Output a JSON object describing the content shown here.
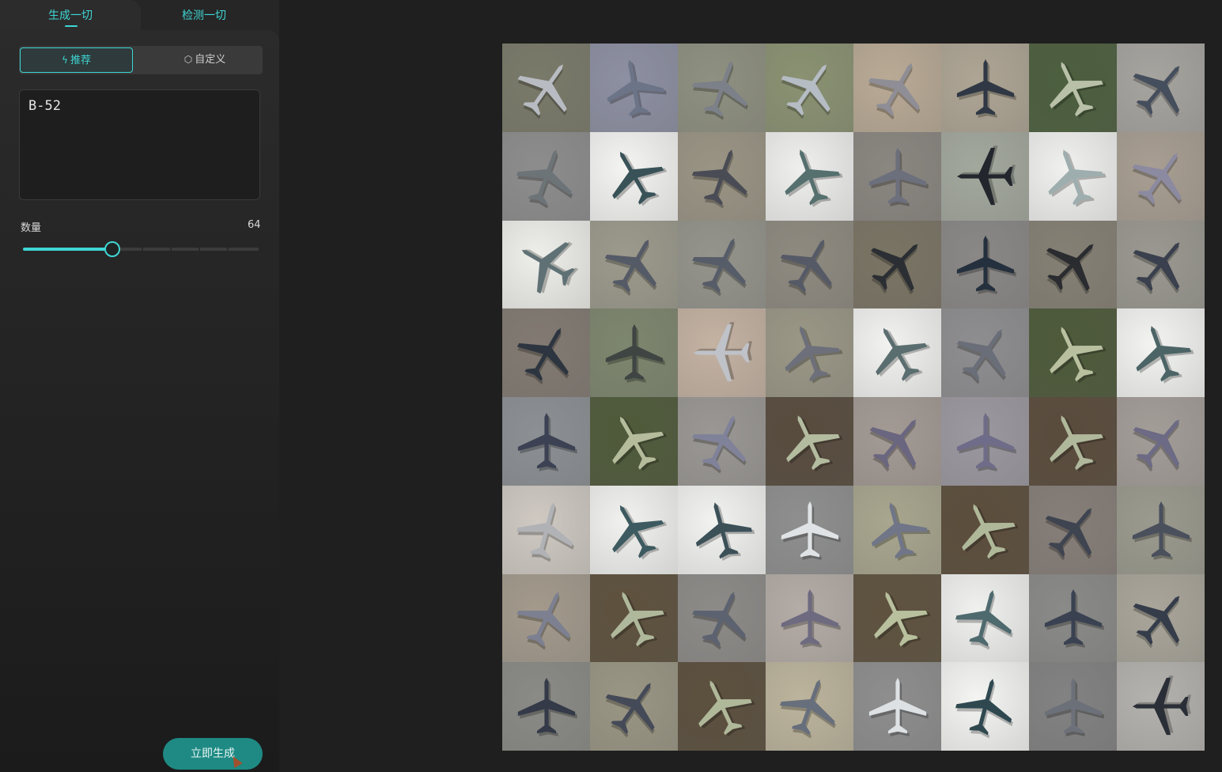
{
  "tabs": [
    {
      "label": "生成一切",
      "active": true
    },
    {
      "label": "检测一切",
      "active": false
    }
  ],
  "mode": {
    "recommend_icon": "lightning-icon",
    "recommend_label": "推荐",
    "custom_icon": "cube-icon",
    "custom_label": "自定义",
    "selected": "recommend"
  },
  "prompt": {
    "value": "B-52"
  },
  "count": {
    "label": "数量",
    "value": "64",
    "min": 0,
    "max": 170
  },
  "generate_button": {
    "label": "立即生成"
  },
  "colors": {
    "accent": "#3fd6d4",
    "button": "#1f8a84"
  },
  "results": {
    "count": 64,
    "subject": "B-52 aircraft satellite images",
    "tiles": [
      {
        "bg": "#7a7a6a",
        "plane": "#b8bcc2",
        "rot": 35
      },
      {
        "bg": "#8d90a2",
        "plane": "#6c7488",
        "rot": -10
      },
      {
        "bg": "#8e9080",
        "plane": "#7c8088",
        "rot": 20
      },
      {
        "bg": "#8a9272",
        "plane": "#b6bcc4",
        "rot": 35
      },
      {
        "bg": "#b9aa95",
        "plane": "#8f8e96",
        "rot": 30
      },
      {
        "bg": "#aea594",
        "plane": "#2f3844",
        "rot": 0
      },
      {
        "bg": "#4c5f3e",
        "plane": "#b9c0a8",
        "rot": -25
      },
      {
        "bg": "#a6a49f",
        "plane": "#454e5c",
        "rot": 40
      },
      {
        "bg": "#8d8d8d",
        "plane": "#6d7478",
        "rot": 20
      },
      {
        "bg": "#f4f4f2",
        "plane": "#385258",
        "rot": -30
      },
      {
        "bg": "#9a9484",
        "plane": "#4a4c55",
        "rot": 20
      },
      {
        "bg": "#efefee",
        "plane": "#55706e",
        "rot": -20
      },
      {
        "bg": "#8a8680",
        "plane": "#6c6f7c",
        "rot": 0
      },
      {
        "bg": "#a3a89d",
        "plane": "#23262d",
        "rot": -90
      },
      {
        "bg": "#f0f1ef",
        "plane": "#9eaeae",
        "rot": -20
      },
      {
        "bg": "#a89e92",
        "plane": "#8c8aa0",
        "rot": 35
      },
      {
        "bg": "#eeeeea",
        "plane": "#5f7174",
        "rot": -60
      },
      {
        "bg": "#9c9a8c",
        "plane": "#545a66",
        "rot": 30
      },
      {
        "bg": "#94948c",
        "plane": "#565c68",
        "rot": 25
      },
      {
        "bg": "#8e8a80",
        "plane": "#555a66",
        "rot": 30
      },
      {
        "bg": "#7a7464",
        "plane": "#2b2f33",
        "rot": 45
      },
      {
        "bg": "#8a8886",
        "plane": "#25303e",
        "rot": 0
      },
      {
        "bg": "#858074",
        "plane": "#2a2c30",
        "rot": 45
      },
      {
        "bg": "#9a9890",
        "plane": "#3a404d",
        "rot": 40
      },
      {
        "bg": "#827a72",
        "plane": "#2d3540",
        "rot": 30
      },
      {
        "bg": "#7d866e",
        "plane": "#3e4542",
        "rot": 0
      },
      {
        "bg": "#c4b2a2",
        "plane": "#bfc2c8",
        "rot": -90
      },
      {
        "bg": "#9a9786",
        "plane": "#6d707a",
        "rot": -20
      },
      {
        "bg": "#f2f2f0",
        "plane": "#5a6e70",
        "rot": -30
      },
      {
        "bg": "#8e8e90",
        "plane": "#6a6e78",
        "rot": 35
      },
      {
        "bg": "#4e5a3a",
        "plane": "#b8c0a0",
        "rot": -25
      },
      {
        "bg": "#f3f4f2",
        "plane": "#4c6466",
        "rot": -20
      },
      {
        "bg": "#8c9094",
        "plane": "#3c4254",
        "rot": 0
      },
      {
        "bg": "#4f5a3a",
        "plane": "#b4bc9c",
        "rot": -30
      },
      {
        "bg": "#9a9794",
        "plane": "#80829a",
        "rot": 25
      },
      {
        "bg": "#584c3e",
        "plane": "#b4bca0",
        "rot": -25
      },
      {
        "bg": "#a39a94",
        "plane": "#6a6680",
        "rot": 40
      },
      {
        "bg": "#9c98a0",
        "plane": "#6e6c88",
        "rot": 0
      },
      {
        "bg": "#5a4c3c",
        "plane": "#b0b89c",
        "rot": -25
      },
      {
        "bg": "#a39d98",
        "plane": "#6c6a84",
        "rot": 40
      },
      {
        "bg": "#cfc9c2",
        "plane": "#b0b2b6",
        "rot": 15
      },
      {
        "bg": "#f1f2ef",
        "plane": "#3d5a60",
        "rot": -30
      },
      {
        "bg": "#f2f3f1",
        "plane": "#3c5058",
        "rot": -15
      },
      {
        "bg": "#8e8f8e",
        "plane": "#dfe3e6",
        "rot": 0
      },
      {
        "bg": "#a8a68e",
        "plane": "#707688",
        "rot": -15
      },
      {
        "bg": "#5c4e3c",
        "plane": "#b0b89a",
        "rot": -25
      },
      {
        "bg": "#867e78",
        "plane": "#3e4450",
        "rot": 40
      },
      {
        "bg": "#9a9a8e",
        "plane": "#4a505c",
        "rot": 0
      },
      {
        "bg": "#a39a8c",
        "plane": "#7c8090",
        "rot": 25
      },
      {
        "bg": "#5e523e",
        "plane": "#b0b89c",
        "rot": -25
      },
      {
        "bg": "#8d8b88",
        "plane": "#5c6270",
        "rot": 25
      },
      {
        "bg": "#b4aca6",
        "plane": "#6e6a80",
        "rot": 0
      },
      {
        "bg": "#5f533f",
        "plane": "#b8c09e",
        "rot": -25
      },
      {
        "bg": "#f0f1ef",
        "plane": "#4f6a6e",
        "rot": 15
      },
      {
        "bg": "#8a8a88",
        "plane": "#3a4252",
        "rot": 0
      },
      {
        "bg": "#a9a59a",
        "plane": "#353c4a",
        "rot": 40
      },
      {
        "bg": "#8a8a86",
        "plane": "#343a48",
        "rot": 0
      },
      {
        "bg": "#9a9684",
        "plane": "#454a58",
        "rot": 35
      },
      {
        "bg": "#5c503e",
        "plane": "#b0b89a",
        "rot": -25
      },
      {
        "bg": "#bcb49c",
        "plane": "#676e7c",
        "rot": 20
      },
      {
        "bg": "#8e8e8e",
        "plane": "#dde1e4",
        "rot": 0
      },
      {
        "bg": "#f4f5f3",
        "plane": "#2f4850",
        "rot": 15
      },
      {
        "bg": "#828282",
        "plane": "#6c7078",
        "rot": 0
      },
      {
        "bg": "#b4b2ae",
        "plane": "#2a2e36",
        "rot": -90
      }
    ]
  }
}
